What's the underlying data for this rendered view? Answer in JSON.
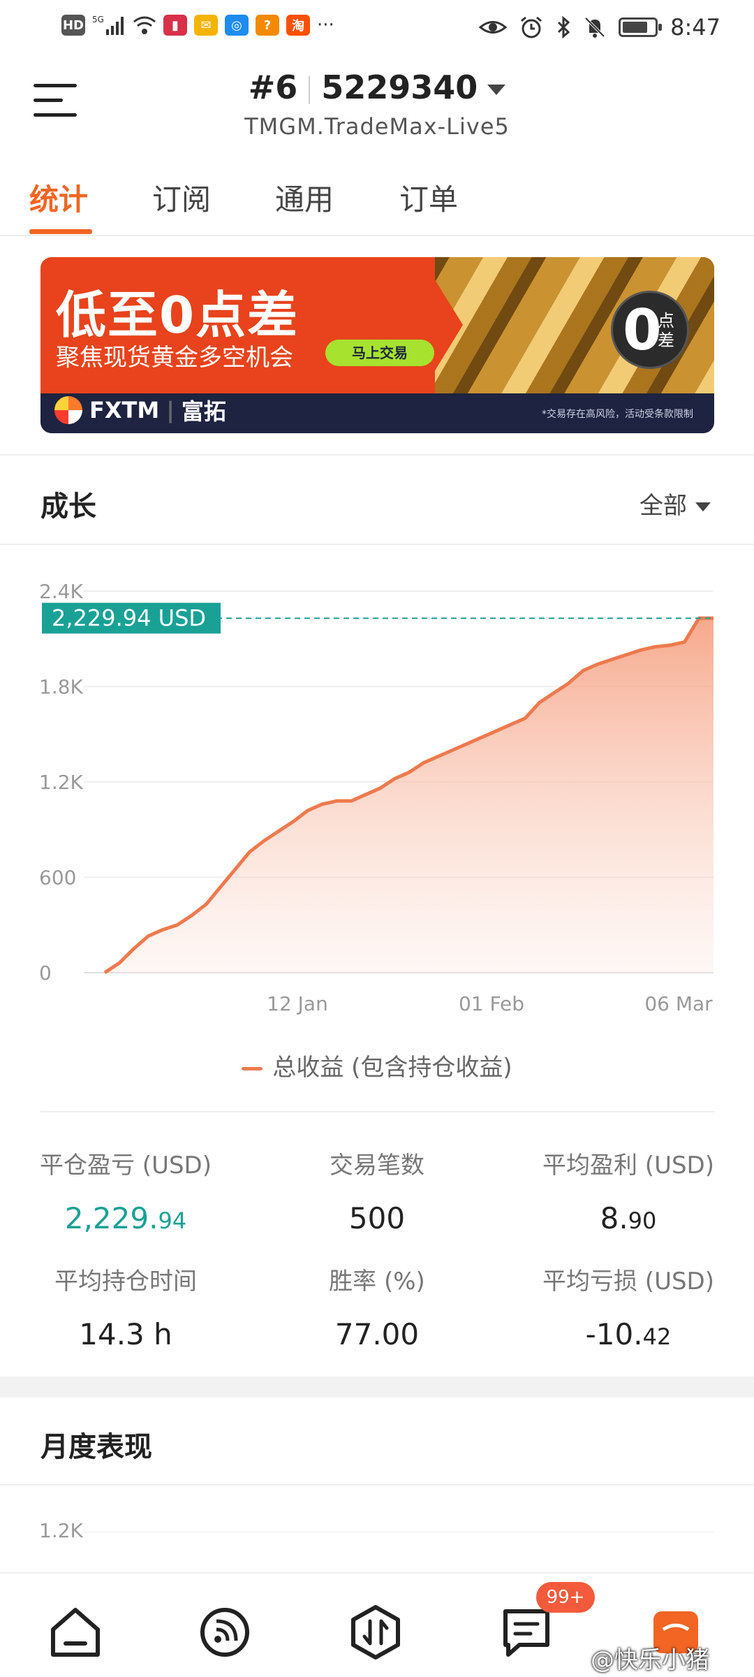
{
  "status_bar": {
    "left_icons": [
      "HD",
      "5G",
      "signal-icon",
      "wifi-icon",
      "app-book-icon",
      "app-mail-icon",
      "app-browser-icon",
      "app-q-icon",
      "taobao-icon",
      "more-dots-icon"
    ],
    "hd_label": "HD",
    "taobao_label": "淘",
    "more_label": "···",
    "time": "8:47"
  },
  "header": {
    "account_number": "#6",
    "account_id": "5229340",
    "server": "TMGM.TradeMax-Live5"
  },
  "tabs": [
    {
      "label": "统计",
      "active": true
    },
    {
      "label": "订阅",
      "active": false
    },
    {
      "label": "通用",
      "active": false
    },
    {
      "label": "订单",
      "active": false
    }
  ],
  "banner": {
    "title": "低至0点差",
    "subtitle": "聚焦现货黄金多空机会",
    "cta": "马上交易",
    "circle_big": "0",
    "circle_small": "点差",
    "brand": "FXTM",
    "brand_cn": "富拓",
    "disclaimer": "*交易存在高风险，活动受条款限制",
    "colors": {
      "primary": "#e8431c",
      "footer": "#1d2340",
      "cta": "#a6e22e"
    }
  },
  "growth": {
    "title": "成长",
    "range_label": "全部",
    "current_value_label": "2,229.94 USD",
    "legend": "总收益 (包含持仓收益)"
  },
  "chart_data": {
    "type": "area",
    "y_ticks": [
      "2.4K",
      "1.8K",
      "1.2K",
      "600",
      "0"
    ],
    "x_ticks": [
      "12 Jan",
      "01 Feb",
      "06 Mar"
    ],
    "ylim": [
      0,
      2400
    ],
    "line_color": "#ee7a4e",
    "marker_color": "#1aa196",
    "marker_value": 2229.94,
    "series": [
      {
        "name": "总收益 (包含持仓收益)",
        "values": [
          0,
          60,
          150,
          230,
          270,
          300,
          360,
          430,
          540,
          650,
          760,
          830,
          890,
          950,
          1020,
          1060,
          1080,
          1080,
          1120,
          1160,
          1220,
          1260,
          1320,
          1360,
          1400,
          1440,
          1480,
          1520,
          1560,
          1600,
          1700,
          1760,
          1820,
          1900,
          1940,
          1970,
          2000,
          2030,
          2050,
          2060,
          2080,
          2230,
          2229.94
        ]
      }
    ]
  },
  "stats": {
    "items": [
      {
        "label": "平仓盈亏 (USD)",
        "int": "2,229.",
        "dec": "94",
        "green": true
      },
      {
        "label": "交易笔数",
        "int": "500",
        "dec": "",
        "green": false
      },
      {
        "label": "平均盈利 (USD)",
        "int": "8.",
        "dec": "90",
        "green": false
      },
      {
        "label": "平均持仓时间",
        "int": "14.3 h",
        "dec": "",
        "green": false
      },
      {
        "label": "胜率 (%)",
        "int": "77.00",
        "dec": "",
        "green": false
      },
      {
        "label": "平均亏损 (USD)",
        "int": "-10.",
        "dec": "42",
        "green": false
      }
    ]
  },
  "monthly": {
    "title": "月度表现",
    "y_tick_top": "1.2K"
  },
  "bottom_nav": {
    "items": [
      "home-icon",
      "feed-icon",
      "trade-icon",
      "messages-icon",
      "profile-icon"
    ],
    "badge": "99+",
    "watermark": "@快乐小猪"
  }
}
